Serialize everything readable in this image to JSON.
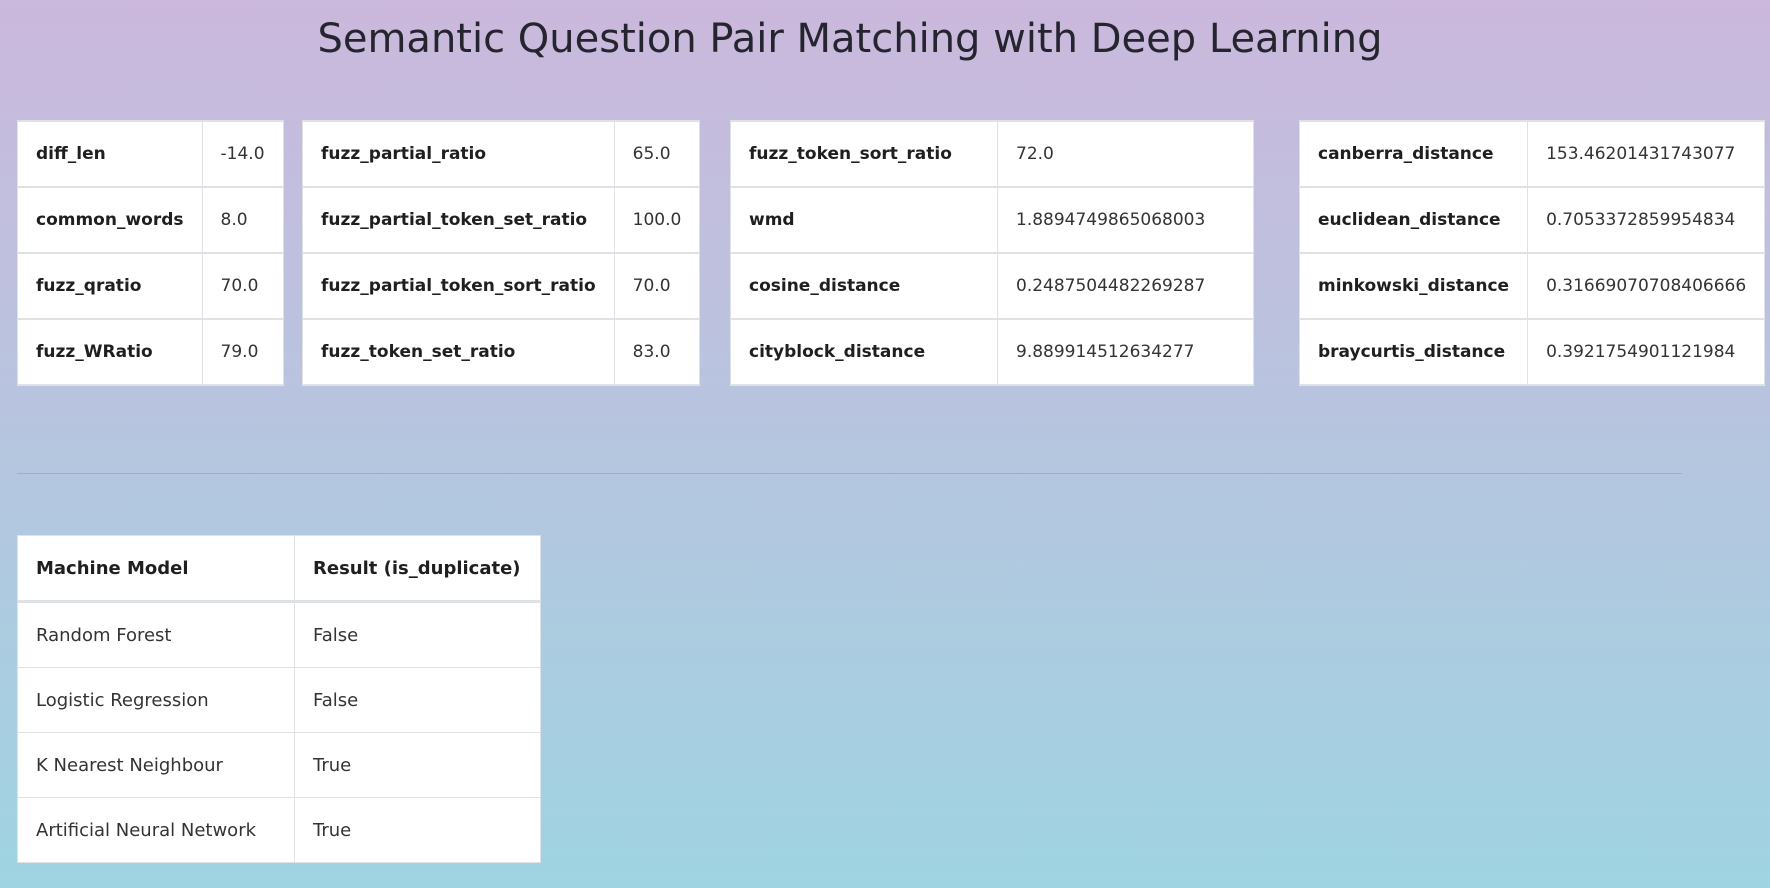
{
  "page": {
    "title": "Semantic Question Pair Matching with Deep Learning"
  },
  "features": {
    "group1": [
      {
        "name": "diff_len",
        "value": "-14.0"
      },
      {
        "name": "common_words",
        "value": "8.0"
      },
      {
        "name": "fuzz_qratio",
        "value": "70.0"
      },
      {
        "name": "fuzz_WRatio",
        "value": "79.0"
      }
    ],
    "group2": [
      {
        "name": "fuzz_partial_ratio",
        "value": "65.0"
      },
      {
        "name": "fuzz_partial_token_set_ratio",
        "value": "100.0"
      },
      {
        "name": "fuzz_partial_token_sort_ratio",
        "value": "70.0"
      },
      {
        "name": "fuzz_token_set_ratio",
        "value": "83.0"
      }
    ],
    "group3": [
      {
        "name": "fuzz_token_sort_ratio",
        "value": "72.0"
      },
      {
        "name": "wmd",
        "value": "1.8894749865068003"
      },
      {
        "name": "cosine_distance",
        "value": "0.2487504482269287"
      },
      {
        "name": "cityblock_distance",
        "value": "9.889914512634277"
      }
    ],
    "group4": [
      {
        "name": "canberra_distance",
        "value": "153.46201431743077"
      },
      {
        "name": "euclidean_distance",
        "value": "0.7053372859954834"
      },
      {
        "name": "minkowski_distance",
        "value": "0.31669070708406666"
      },
      {
        "name": "braycurtis_distance",
        "value": "0.3921754901121984"
      }
    ]
  },
  "results": {
    "headers": [
      "Machine Model",
      "Result (is_duplicate)"
    ],
    "rows": [
      {
        "model": "Random Forest",
        "result": "False"
      },
      {
        "model": "Logistic Regression",
        "result": "False"
      },
      {
        "model": "K Nearest Neighbour",
        "result": "True"
      },
      {
        "model": "Artificial Neural Network",
        "result": "True"
      }
    ]
  }
}
